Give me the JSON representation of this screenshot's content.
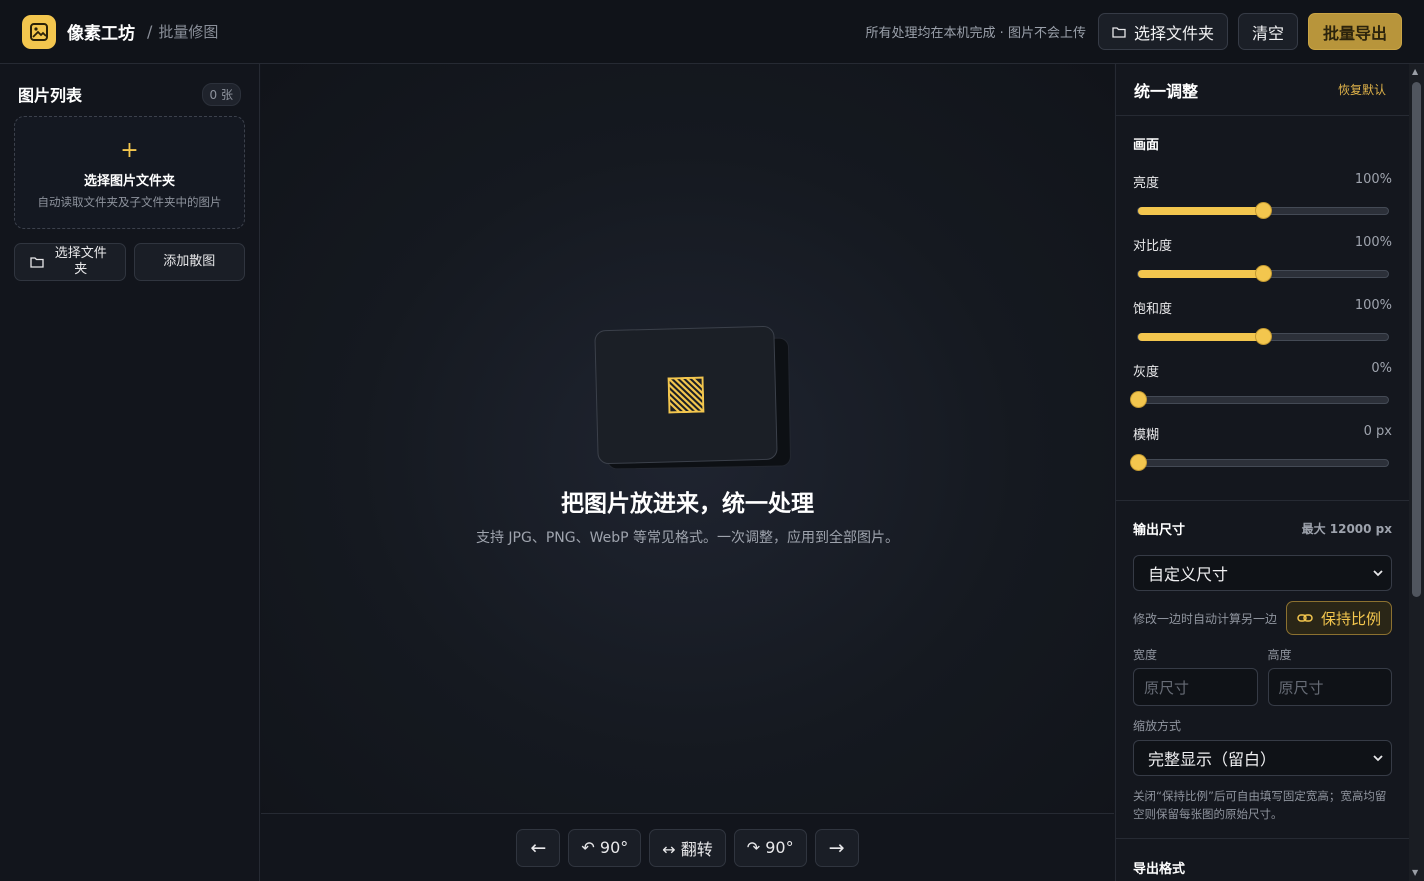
{
  "header": {
    "brand": "像素工坊",
    "separator": "/",
    "page": "批量修图",
    "privacy": "所有处理均在本机完成 · 图片不会上传",
    "select_folder": "选择文件夹",
    "clear": "清空",
    "export": "批量导出"
  },
  "sidebar": {
    "title": "图片列表",
    "count": "0 张",
    "dropzone_plus": "+",
    "dropzone_title": "选择图片文件夹",
    "dropzone_sub": "自动读取文件夹及子文件夹中的图片",
    "select_folder": "选择文件夹",
    "add_images": "添加散图"
  },
  "stage": {
    "title": "把图片放进来，统一处理",
    "subtitle": "支持 JPG、PNG、WebP 等常见格式。一次调整，应用到全部图片。"
  },
  "toolbar": {
    "prev": "←",
    "rotate_left": "↶ 90°",
    "flip": "↔ 翻转",
    "rotate_right": "↷ 90°",
    "next": "→"
  },
  "panel": {
    "title": "统一调整",
    "reset": "恢复默认",
    "picture": {
      "title": "画面",
      "sliders": [
        {
          "label": "亮度",
          "value": "100%",
          "fraction": 0.5
        },
        {
          "label": "对比度",
          "value": "100%",
          "fraction": 0.5
        },
        {
          "label": "饱和度",
          "value": "100%",
          "fraction": 0.5
        },
        {
          "label": "灰度",
          "value": "0%",
          "fraction": 0
        },
        {
          "label": "模糊",
          "value": "0 px",
          "fraction": 0
        }
      ]
    },
    "output": {
      "title": "输出尺寸",
      "max": "最大 12000 px",
      "size_mode": "自定义尺寸",
      "ratio_hint": "修改一边时自动计算另一边",
      "ratio_button": "保持比例",
      "width_label": "宽度",
      "height_label": "高度",
      "width_placeholder": "原尺寸",
      "height_placeholder": "原尺寸",
      "scale_label": "缩放方式",
      "scale_mode": "完整显示（留白）",
      "note": "关闭“保持比例”后可自由填写固定宽高；宽高均留空则保留每张图的原始尺寸。"
    },
    "format": {
      "title": "导出格式"
    }
  },
  "colors": {
    "accent": "#f3c64e",
    "background": "#12151c",
    "export_button": "#b8953b"
  }
}
